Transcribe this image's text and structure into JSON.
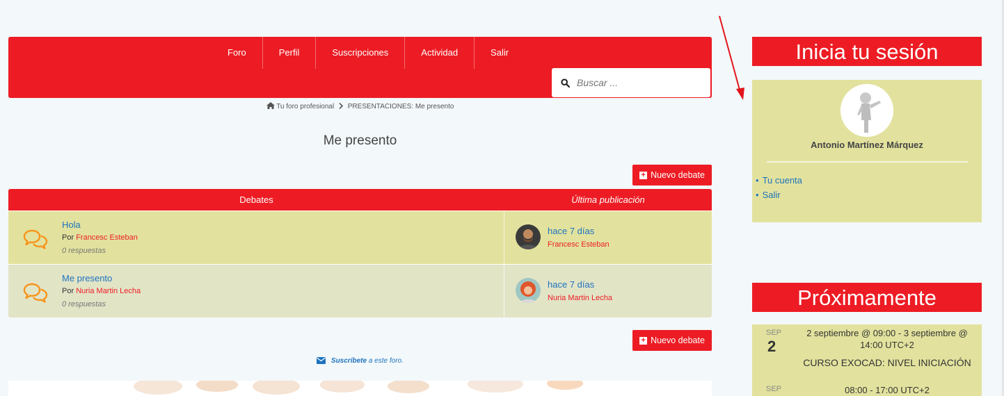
{
  "nav": {
    "items": [
      "Foro",
      "Perfil",
      "Suscripciones",
      "Actividad",
      "Salir"
    ],
    "search_placeholder": "Buscar ..."
  },
  "breadcrumb": {
    "home": "Tu foro profesional",
    "current": "PRESENTACIONES: Me presento"
  },
  "page_title": "Me presento",
  "new_topic_label": "Nuevo debate",
  "table": {
    "col_debates": "Debates",
    "col_last": "Última publicación",
    "rows": [
      {
        "title": "Hola",
        "by_prefix": "Por",
        "author": "Francesc Esteban",
        "replies": "0 respuestas",
        "freshness": "hace 7 días",
        "last_author": "Francesc Esteban"
      },
      {
        "title": "Me presento",
        "by_prefix": "Por",
        "author": "Nuria Martin Lecha",
        "replies": "0 respuestas",
        "freshness": "hace 7 días",
        "last_author": "Nuria Martin Lecha"
      }
    ]
  },
  "subscribe": {
    "bold": "Suscríbete",
    "rest": "a este foro."
  },
  "sidebar": {
    "login_title": "Inicia tu sesión",
    "user_name": "Antonio Martínez Márquez",
    "links": [
      "Tu cuenta",
      "Salir"
    ],
    "upcoming_title": "Próximamente",
    "events": [
      {
        "month": "SEP",
        "day": "2",
        "time": "2 septiembre @ 09:00 - 3 septiembre @ 14:00 UTC+2",
        "name": "CURSO EXOCAD: NIVEL INICIACIÓN"
      },
      {
        "month": "SEP",
        "day": "",
        "time": "08:00 - 17:00 UTC+2",
        "name": ""
      }
    ]
  },
  "colors": {
    "brand_red": "#ed1c24",
    "row_yellow": "#e2e29e",
    "row_beige": "#e2e4c6",
    "link_blue": "#1e73be",
    "icon_orange": "#f7941d"
  }
}
